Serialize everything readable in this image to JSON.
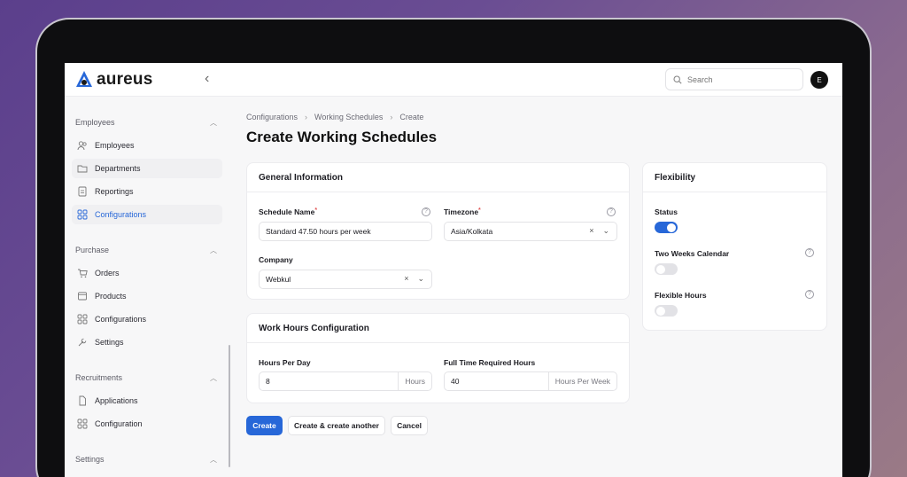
{
  "app": {
    "name": "aureus"
  },
  "header": {
    "search_placeholder": "Search",
    "avatar_initial": "E"
  },
  "sidebar": {
    "sections": [
      {
        "title": "Employees",
        "items": [
          "Employees",
          "Departments",
          "Reportings",
          "Configurations"
        ]
      },
      {
        "title": "Purchase",
        "items": [
          "Orders",
          "Products",
          "Configurations",
          "Settings"
        ]
      },
      {
        "title": "Recruitments",
        "items": [
          "Applications",
          "Configuration"
        ]
      },
      {
        "title": "Settings",
        "items": []
      }
    ],
    "active_item": "Configurations"
  },
  "breadcrumb": [
    "Configurations",
    "Working Schedules",
    "Create"
  ],
  "page_title": "Create Working Schedules",
  "general": {
    "title": "General Information",
    "schedule_name_label": "Schedule Name",
    "schedule_name_value": "Standard 47.50 hours per week",
    "timezone_label": "Timezone",
    "timezone_value": "Asia/Kolkata",
    "company_label": "Company",
    "company_value": "Webkul"
  },
  "work_hours": {
    "title": "Work Hours Configuration",
    "hours_per_day_label": "Hours Per Day",
    "hours_per_day_value": "8",
    "hours_per_day_suffix": "Hours",
    "full_time_label": "Full Time Required Hours",
    "full_time_value": "40",
    "full_time_suffix": "Hours Per Week"
  },
  "flexibility": {
    "title": "Flexibility",
    "status_label": "Status",
    "status_on": true,
    "two_weeks_label": "Two Weeks Calendar",
    "two_weeks_on": false,
    "flexible_hours_label": "Flexible Hours",
    "flexible_hours_on": false
  },
  "actions": {
    "create": "Create",
    "create_another": "Create & create another",
    "cancel": "Cancel"
  },
  "colors": {
    "accent": "#2767d8",
    "required": "#e25555"
  }
}
